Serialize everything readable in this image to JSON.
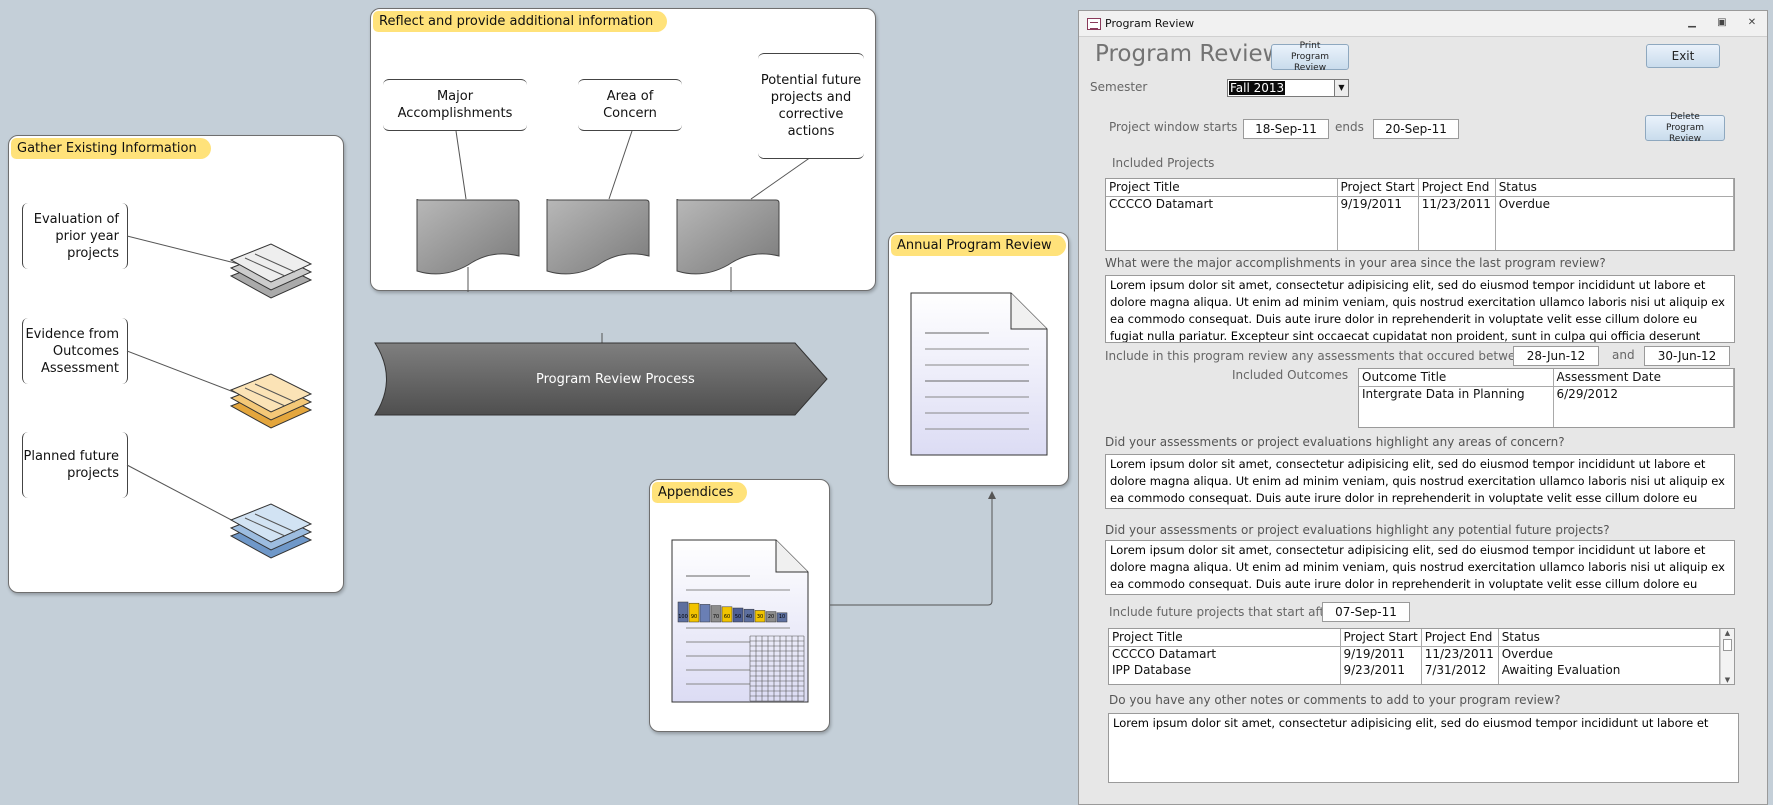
{
  "diagram": {
    "gather": {
      "title": "Gather Existing Information",
      "items": [
        "Evaluation of prior year projects",
        "Evidence from Outcomes Assessment",
        "Planned future projects"
      ]
    },
    "reflect": {
      "title": "Reflect and provide additional information",
      "items": [
        "Major Accomplishments",
        "Area of Concern",
        "Potential future projects and corrective actions"
      ]
    },
    "process_label": "Program Review Process",
    "annual": {
      "title": "Annual Program Review"
    },
    "appendices": {
      "title": "Appendices",
      "chart_cells": [
        "100",
        "90",
        "",
        "70",
        "60",
        "50",
        "40",
        "30",
        "20",
        "10"
      ]
    }
  },
  "form": {
    "window_title": "Program Review",
    "heading": "Program Review",
    "print_button": "Print Program Review",
    "exit_button": "Exit",
    "semester_label": "Semester",
    "semester_value": "Fall 2013",
    "window_starts_label": "Project window starts",
    "window_start": "18-Sep-11",
    "ends_label": "ends",
    "window_end": "20-Sep-11",
    "delete_button": "Delete Program Review",
    "included_projects_label": "Included Projects",
    "projects_grid": {
      "columns": [
        "Project Title",
        "Project Start",
        "Project End",
        "Status"
      ],
      "rows": [
        [
          "CCCCO Datamart",
          "9/19/2011",
          "11/23/2011",
          "Overdue"
        ]
      ]
    },
    "q1": "What were the major accomplishments in your area since the last program review?",
    "a1": "Lorem ipsum dolor sit amet, consectetur adipisicing elit, sed do eiusmod tempor incididunt ut labore et dolore magna aliqua. Ut enim ad minim veniam, quis nostrud exercitation ullamco laboris nisi ut aliquip ex ea commodo consequat. Duis aute irure dolor in reprehenderit in voluptate velit esse cillum dolore eu fugiat nulla pariatur. Excepteur sint occaecat cupidatat non proident, sunt in culpa qui officia deserunt mollit anim",
    "assessments_label": "Include in this program review any assessments that occured between",
    "assess_start": "28-Jun-12",
    "and_label": "and",
    "assess_end": "30-Jun-12",
    "included_outcomes_label": "Included Outcomes",
    "outcomes_grid": {
      "columns": [
        "Outcome Title",
        "Assessment Date"
      ],
      "rows": [
        [
          "Intergrate Data in Planning",
          "6/29/2012"
        ]
      ]
    },
    "q2": "Did your assessments or project evaluations highlight any areas of concern?",
    "a2": "Lorem ipsum dolor sit amet, consectetur adipisicing elit, sed do eiusmod tempor incididunt ut labore et dolore magna aliqua. Ut enim ad minim veniam, quis nostrud exercitation ullamco laboris nisi ut aliquip ex ea commodo consequat. Duis aute irure dolor in reprehenderit in voluptate velit esse cillum dolore eu fugiat",
    "q3": "Did your assessments or project evaluations highlight any potential future projects?",
    "a3": "Lorem ipsum dolor sit amet, consectetur adipisicing elit, sed do eiusmod tempor incididunt ut labore et dolore magna aliqua. Ut enim ad minim veniam, quis nostrud exercitation ullamco laboris nisi ut aliquip ex ea commodo consequat. Duis aute irure dolor in reprehenderit in voluptate velit esse cillum dolore eu",
    "future_label": "Include future projects that start after",
    "future_date": "07-Sep-11",
    "future_grid": {
      "columns": [
        "Project Title",
        "Project Start",
        "Project End",
        "Status"
      ],
      "rows": [
        [
          "CCCCO Datamart",
          "9/19/2011",
          "11/23/2011",
          "Overdue"
        ],
        [
          "IPP Database",
          "9/23/2011",
          "7/31/2012",
          "Awaiting Evaluation"
        ]
      ]
    },
    "q4": "Do you have any other notes or comments to add to your program review?",
    "a4": "Lorem ipsum dolor sit amet, consectetur adipisicing elit, sed do eiusmod tempor incididunt ut labore et"
  }
}
